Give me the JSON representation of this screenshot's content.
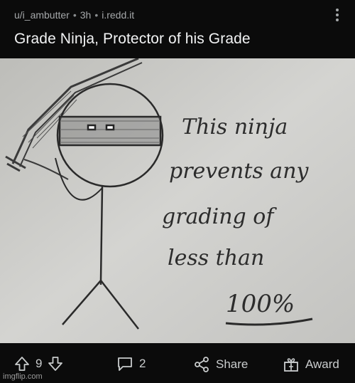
{
  "post": {
    "author": "u/i_ambutter",
    "time": "3h",
    "domain": "i.redd.it",
    "title": "Grade Ninja, Protector of his Grade"
  },
  "drawing_text": {
    "line1": "This ninja",
    "line2": "prevents any",
    "line3": "grading of",
    "line4": "less than",
    "line5": "100%"
  },
  "actions": {
    "upvote_count": "9",
    "comment_count": "2",
    "share_label": "Share",
    "award_label": "Award"
  },
  "watermark": "imgflip.com",
  "colors": {
    "background": "#0b0b0b",
    "paper": "#c9c9c6",
    "ink": "#2a2a2a"
  }
}
